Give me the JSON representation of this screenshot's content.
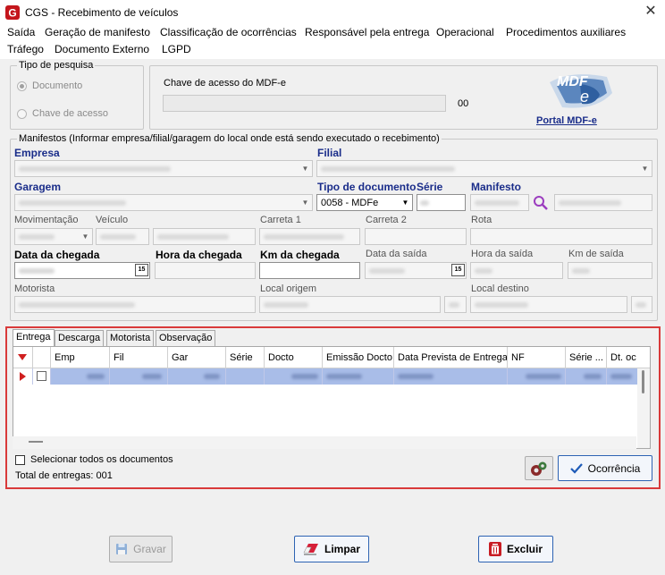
{
  "window": {
    "title": "CGS - Recebimento de veículos"
  },
  "menu": {
    "row1": [
      "Saída",
      "Geração de manifesto",
      "Classificação de ocorrências",
      "Responsável pela entrega",
      "Operacional",
      "Procedimentos auxiliares"
    ],
    "row2": [
      "Tráfego",
      "Documento Externo",
      "LGPD"
    ]
  },
  "search_type": {
    "legend": "Tipo de pesquisa",
    "option_documento": "Documento",
    "option_chave": "Chave de acesso",
    "selected": "Documento"
  },
  "mdfe": {
    "label": "Chave de acesso do MDF-e",
    "value": "",
    "counter": "00",
    "portal_link": "Portal MDF-e",
    "logo_text": "MDF e"
  },
  "manifestos": {
    "legend": "Manifestos (Informar empresa/filial/garagem do local onde está sendo executado o recebimento)",
    "empresa_label": "Empresa",
    "filial_label": "Filial",
    "garagem_label": "Garagem",
    "tipo_doc_label": "Tipo de documento",
    "serie_label": "Série",
    "manifesto_label": "Manifesto",
    "tipo_doc_value": "0058 - MDFe",
    "movimentacao_label": "Movimentação",
    "veiculo_label": "Veículo",
    "carreta1_label": "Carreta 1",
    "carreta2_label": "Carreta 2",
    "rota_label": "Rota",
    "data_chegada_label": "Data da chegada",
    "hora_chegada_label": "Hora da chegada",
    "km_chegada_label": "Km da chegada",
    "data_saida_label": "Data da saída",
    "hora_saida_label": "Hora da saída",
    "km_saida_label": "Km de saída",
    "motorista_label": "Motorista",
    "local_origem_label": "Local origem",
    "local_destino_label": "Local destino",
    "calendar_glyph": "15"
  },
  "tabs": [
    "Entrega",
    "Descarga",
    "Motorista",
    "Observação"
  ],
  "active_tab": "Entrega",
  "grid": {
    "columns": [
      "Emp",
      "Fil",
      "Gar",
      "Série",
      "Docto",
      "Emissão Docto",
      "Data Prevista de Entrega",
      "NF",
      "Série ...",
      "Dt. oc"
    ]
  },
  "footer": {
    "select_all_label": "Selecionar todos os documentos",
    "total_label": "Total de entregas: 001",
    "ocorrencia_button": "Ocorrência",
    "gravar_button": "Gravar",
    "limpar_button": "Limpar",
    "excluir_button": "Excluir"
  },
  "colors": {
    "accent_blue": "#1a2d8a",
    "highlight_red": "#d93a3a",
    "selected_row": "#a9bde8"
  }
}
